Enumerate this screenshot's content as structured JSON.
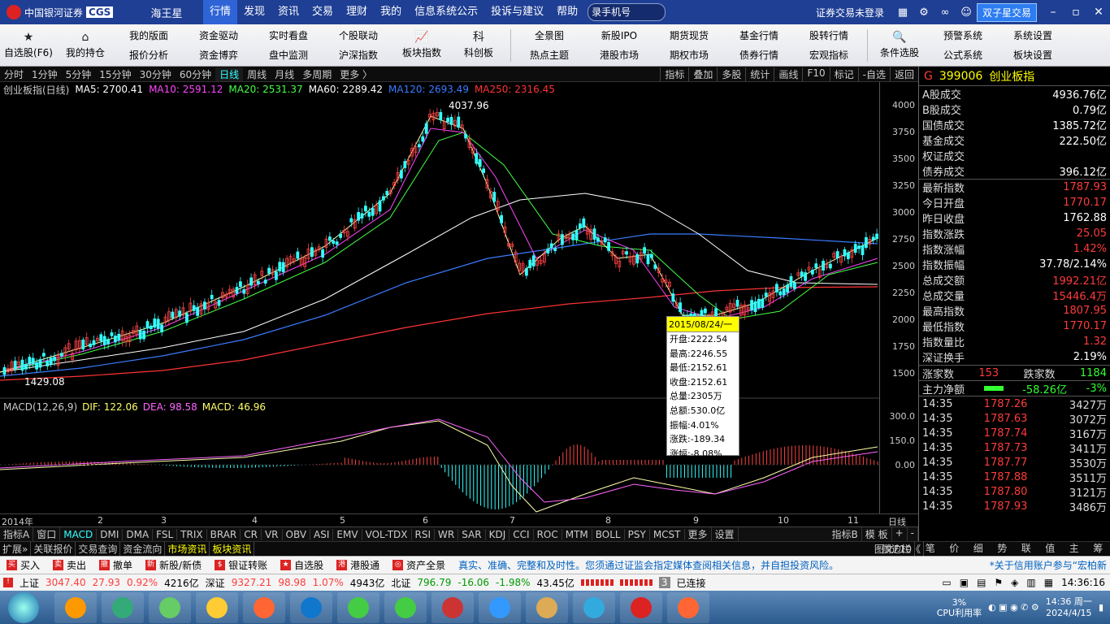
{
  "menubar": {
    "logo_text": "中国银河证券",
    "logo_code": "CGS",
    "app_name": "海王星",
    "items": [
      "行情",
      "发现",
      "资讯",
      "交易",
      "理财",
      "我的",
      "信息系统公示",
      "投诉与建议",
      "帮助"
    ],
    "phone_value": "录手机号",
    "login_text": "证券交易未登录",
    "twin_btn": "双子星交易"
  },
  "toolbar": {
    "left": [
      {
        "icon": "star",
        "label": "自选股(F6)"
      },
      {
        "icon": "home",
        "label": "我的持仓"
      }
    ],
    "pairs": [
      [
        "我的版面",
        "报价分析"
      ],
      [
        "资金驱动",
        "资金博弈"
      ],
      [
        "实时看盘",
        "盘中监测"
      ],
      [
        "个股联动",
        "沪深指数"
      ]
    ],
    "mid": [
      {
        "icon": "chart",
        "label": "板块指数"
      },
      {
        "icon": "kechuang",
        "label": "科创板"
      }
    ],
    "pairs2": [
      [
        "全景图",
        "热点主题"
      ],
      [
        "新股IPO",
        "港股市场"
      ],
      [
        "期货现货",
        "期权市场"
      ],
      [
        "基金行情",
        "债券行情"
      ],
      [
        "股转行情",
        "宏观指标"
      ]
    ],
    "right": [
      {
        "icon": "search-chart",
        "label": "条件选股"
      }
    ],
    "pairs3": [
      [
        "预警系统",
        "公式系统"
      ],
      [
        "系统设置",
        "板块设置"
      ]
    ]
  },
  "periods": [
    "分时",
    "1分钟",
    "5分钟",
    "15分钟",
    "30分钟",
    "60分钟",
    "日线",
    "周线",
    "月线",
    "多周期",
    "更多 〉"
  ],
  "right_tools": [
    "指标",
    "叠加",
    "多股",
    "统计",
    "画线",
    "F10",
    "标记",
    "-自选",
    "返回"
  ],
  "chart_info": {
    "name": "创业板指(日线)",
    "ma": [
      {
        "label": "MA5: 2700.41",
        "color": "#ffffff"
      },
      {
        "label": "MA10: 2591.12",
        "color": "#ff44ff"
      },
      {
        "label": "MA20: 2531.37",
        "color": "#44ff44"
      },
      {
        "label": "MA60: 2289.42",
        "color": "#ffffff"
      },
      {
        "label": "MA120: 2693.49",
        "color": "#3a7bff"
      },
      {
        "label": "MA250: 2316.45",
        "color": "#ff3333"
      }
    ],
    "high_label": "4037.96",
    "low_label": "1429.08",
    "macd_label": "MACD(12,26,9)",
    "dif": "DIF: 122.06",
    "dea": "DEA: 98.58",
    "macd": "MACD: 46.96"
  },
  "yticks": [
    "4000",
    "3750",
    "3500",
    "3250",
    "3000",
    "2750",
    "2500",
    "2250",
    "2000",
    "1750",
    "1500"
  ],
  "macd_ticks": [
    "300.0",
    "150.0",
    "0.00"
  ],
  "dates": [
    "2014年",
    "2",
    "3",
    "4",
    "5",
    "6",
    "7",
    "8",
    "9",
    "10",
    "11",
    "日线"
  ],
  "tooltip": {
    "date": "2015/08/24/一",
    "rows": [
      "开盘:2222.54",
      "最高:2246.55",
      "最低:2152.61",
      "收盘:2152.61",
      "总量:2305万",
      "总额:530.0亿",
      "振幅:4.01%",
      "涨跌:-189.34",
      "涨幅:-8.08%"
    ]
  },
  "indicators": [
    "指标A",
    "窗口",
    "MACD",
    "DMI",
    "DMA",
    "FSL",
    "TRIX",
    "BRAR",
    "CR",
    "VR",
    "OBV",
    "ASI",
    "EMV",
    "VOL-TDX",
    "RSI",
    "WR",
    "SAR",
    "KDJ",
    "CCI",
    "ROC",
    "MTM",
    "BOLL",
    "PSY",
    "MCST",
    "更多",
    "设置"
  ],
  "ind_right": [
    "指标B",
    "模 板",
    "+",
    "-"
  ],
  "ext_tabs": [
    "扩展»",
    "关联报价",
    "交易查询",
    "资金流向",
    "市场资讯",
    "板块资讯"
  ],
  "ext_right": [
    "图文F10",
    "侧边栏《"
  ],
  "right_panel": {
    "code": "399006",
    "name": "创业板指",
    "turnover": [
      [
        "A股成交",
        "4936.76亿"
      ],
      [
        "B股成交",
        "0.79亿"
      ],
      [
        "国债成交",
        "1385.72亿"
      ],
      [
        "基金成交",
        "222.50亿"
      ],
      [
        "权证成交",
        ""
      ],
      [
        "债券成交",
        "396.12亿"
      ]
    ],
    "stats": [
      [
        "最新指数",
        "1787.93",
        "red"
      ],
      [
        "今日开盘",
        "1770.17",
        "red"
      ],
      [
        "昨日收盘",
        "1762.88",
        ""
      ],
      [
        "指数涨跌",
        "25.05",
        "red"
      ],
      [
        "指数涨幅",
        "1.42%",
        "red"
      ],
      [
        "指数振幅",
        "37.78/2.14%",
        ""
      ],
      [
        "总成交额",
        "1992.21亿",
        "red"
      ],
      [
        "总成交量",
        "15446.4万",
        "red"
      ],
      [
        "最高指数",
        "1807.95",
        "red"
      ],
      [
        "最低指数",
        "1770.17",
        "red"
      ],
      [
        "指数量比",
        "1.32",
        "red"
      ],
      [
        "深证换手",
        "2.19%",
        ""
      ]
    ],
    "up_label": "涨家数",
    "up": "153",
    "down_label": "跌家数",
    "down": "1184",
    "flow_label": "主力净额",
    "flow": "-58.26亿",
    "flow_pct": "-3%",
    "ticks": [
      [
        "14:35",
        "1787.26",
        "3427万"
      ],
      [
        "14:35",
        "1787.63",
        "3072万"
      ],
      [
        "14:35",
        "1787.74",
        "3167万"
      ],
      [
        "14:35",
        "1787.73",
        "3411万"
      ],
      [
        "14:35",
        "1787.77",
        "3530万"
      ],
      [
        "14:35",
        "1787.88",
        "3511万"
      ],
      [
        "14:35",
        "1787.80",
        "3121万"
      ],
      [
        "14:35",
        "1787.93",
        "3486万"
      ]
    ]
  },
  "bottom_tabs": [
    "笔",
    "价",
    "细",
    "势",
    "联",
    "值",
    "主",
    "筹"
  ],
  "orderbar": {
    "buttons": [
      "买入",
      "卖出",
      "撤单",
      "新股/新债",
      "银证转账",
      "自选股",
      "港股通",
      "资产全景"
    ],
    "notice": "真实、准确、完整和及时性。您须通过证监会指定媒体查阅相关信息，并自担投资风险。",
    "credit": "*关于信用账户参与“宏柏新"
  },
  "indexbar": {
    "sh_label": "上证",
    "sh": "3047.40",
    "sh_chg": "27.93",
    "sh_pct": "0.92%",
    "sh_vol": "4216亿",
    "sz_label": "深证",
    "sz": "9327.21",
    "sz_chg": "98.98",
    "sz_pct": "1.07%",
    "sz_vol": "4943亿",
    "bj_label": "北证",
    "bj": "796.79",
    "bj_chg": "-16.06",
    "bj_pct": "-1.98%",
    "bj_vol": "43.45亿",
    "conn": "3",
    "conn_text": "已连接",
    "time": "14:36:16"
  },
  "taskbar": {
    "apps": [
      "",
      "",
      "3...",
      "",
      "",
      "",
      "",
      "",
      "",
      "",
      "",
      "",
      "C...",
      "K",
      "W",
      ""
    ],
    "cpu": "3%",
    "cpu_label": "CPU利用率",
    "time": "14:36 周一",
    "date": "2024/4/15"
  }
}
